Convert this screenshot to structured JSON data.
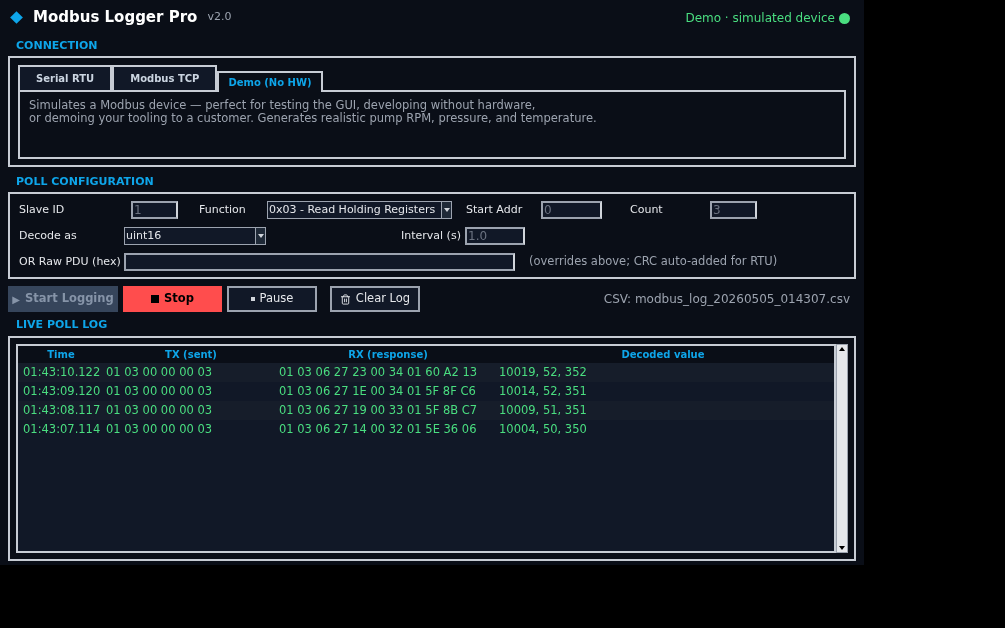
{
  "header": {
    "title": "Modbus Logger Pro",
    "version": "v2.0",
    "status": {
      "text": "Demo · simulated device",
      "color": "#4ade80"
    }
  },
  "connection": {
    "heading": "CONNECTION",
    "tabs": [
      {
        "label": "Serial RTU",
        "selected": false
      },
      {
        "label": "Modbus TCP",
        "selected": false
      },
      {
        "label": "Demo (No HW)",
        "selected": true
      }
    ],
    "description": [
      "Simulates a Modbus device — perfect for testing the GUI, developing without hardware,",
      "or demoing your tooling to a customer. Generates realistic pump RPM, pressure, and temperature."
    ]
  },
  "poll": {
    "heading": "POLL CONFIGURATION",
    "slave_id": {
      "label": "Slave ID",
      "value": "1"
    },
    "function": {
      "label": "Function",
      "value": "0x03 - Read Holding Registers"
    },
    "start_addr": {
      "label": "Start Addr",
      "value": "0"
    },
    "count": {
      "label": "Count",
      "value": "3"
    },
    "decode": {
      "label": "Decode as",
      "value": "uint16"
    },
    "interval": {
      "label": "Interval (s)",
      "value": "1.0"
    },
    "raw_pdu": {
      "label": "OR Raw PDU (hex)",
      "hint": "(overrides above; CRC auto-added for RTU)"
    }
  },
  "actions": [
    {
      "kind": "start",
      "label": "Start Logging",
      "icon": "▶",
      "disabled": true
    },
    {
      "kind": "stop",
      "label": "Stop",
      "disabled": false
    },
    {
      "kind": "pause",
      "label": "Pause",
      "disabled": false
    },
    {
      "kind": "clear",
      "label": "Clear Log",
      "disabled": false
    }
  ],
  "csv": "CSV: modbus_log_20260505_014307.csv",
  "log": {
    "heading": "LIVE POLL LOG",
    "columns": [
      "Time",
      "TX (sent)",
      "RX (response)",
      "Decoded value"
    ],
    "rows": [
      [
        "01:43:10.122",
        "01 03 00 00 00 03",
        "01 03 06 27 23 00 34 01 60 A2 13",
        "10019, 52, 352"
      ],
      [
        "01:43:09.120",
        "01 03 00 00 00 03",
        "01 03 06 27 1E 00 34 01 5F 8F C6",
        "10014, 52, 351"
      ],
      [
        "01:43:08.117",
        "01 03 00 00 00 03",
        "01 03 06 27 19 00 33 01 5F 8B C7",
        "10009, 51, 351"
      ],
      [
        "01:43:07.114",
        "01 03 00 00 00 03",
        "01 03 06 27 14 00 32 01 5E 36 06",
        "10004, 50, 350"
      ]
    ]
  }
}
